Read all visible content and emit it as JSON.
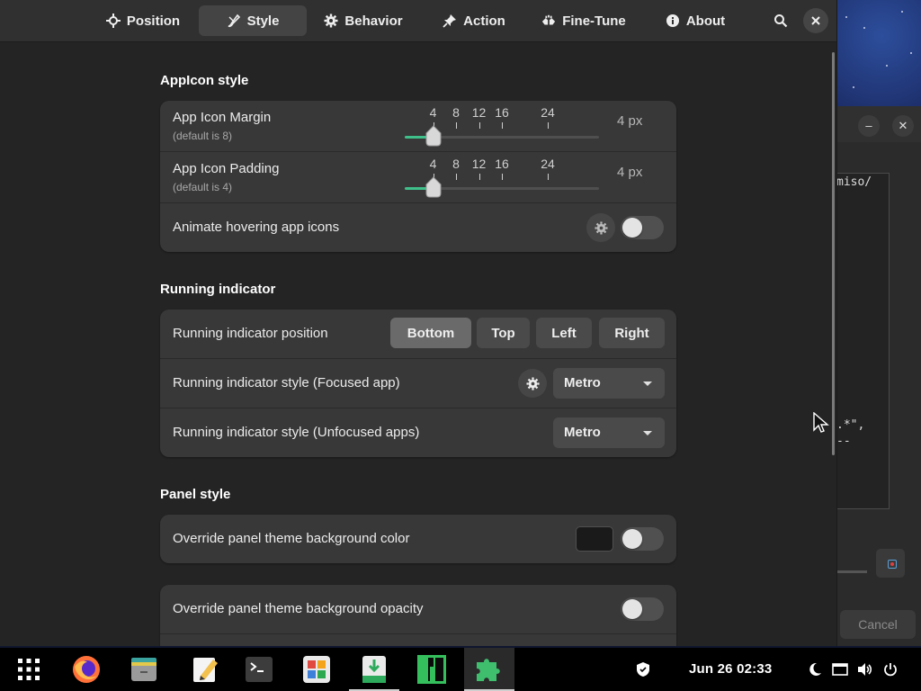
{
  "header": {
    "tabs": [
      {
        "label": "Position",
        "icon": "crosshair-icon"
      },
      {
        "label": "Style",
        "icon": "brush-icon",
        "active": true
      },
      {
        "label": "Behavior",
        "icon": "gear-icon"
      },
      {
        "label": "Action",
        "icon": "pin-icon"
      },
      {
        "label": "Fine-Tune",
        "icon": "hands-icon"
      },
      {
        "label": "About",
        "icon": "info-icon"
      }
    ],
    "search_icon": "search-icon",
    "close_icon": "close-icon"
  },
  "sections": {
    "appicon": {
      "title": "AppIcon style",
      "margin": {
        "label": "App Icon Margin",
        "sub": "(default is 8)",
        "ticks": [
          "4",
          "8",
          "12",
          "16",
          "24"
        ],
        "value": 4,
        "value_text": "4 px",
        "min": 0,
        "max": 32
      },
      "padding": {
        "label": "App Icon Padding",
        "sub": "(default is 4)",
        "ticks": [
          "4",
          "8",
          "12",
          "16",
          "24"
        ],
        "value": 4,
        "value_text": "4 px",
        "min": 0,
        "max": 32
      },
      "animate": {
        "label": "Animate hovering app icons",
        "enabled": false
      }
    },
    "running": {
      "title": "Running indicator",
      "position": {
        "label": "Running indicator position",
        "options": [
          "Bottom",
          "Top",
          "Left",
          "Right"
        ],
        "selected": "Bottom"
      },
      "focused": {
        "label": "Running indicator style (Focused app)",
        "value": "Metro"
      },
      "unfocused": {
        "label": "Running indicator style (Unfocused apps)",
        "value": "Metro"
      }
    },
    "panel": {
      "title": "Panel style",
      "bgcolor": {
        "label": "Override panel theme background color",
        "enabled": false,
        "color": "#1a1a1a"
      },
      "opacity": {
        "label": "Override panel theme background opacity",
        "enabled": false
      }
    }
  },
  "background_window": {
    "text1": "miso/",
    "text2": ".*\",",
    "text3": "--",
    "cancel": "Cancel"
  },
  "taskbar": {
    "apps": [
      "apps-grid-icon",
      "firefox-icon",
      "file-manager-icon",
      "text-editor-icon",
      "terminal-icon",
      "software-center-icon",
      "package-installer-icon",
      "manjaro-icon",
      "extensions-icon"
    ],
    "clock": "Jun 26  02:33",
    "tray": [
      "shield-icon",
      "night-light-icon",
      "window-icon",
      "volume-icon",
      "power-icon"
    ]
  },
  "colors": {
    "accent": "#3fbf8a",
    "window_bg": "#242424",
    "card_bg": "#383838"
  }
}
